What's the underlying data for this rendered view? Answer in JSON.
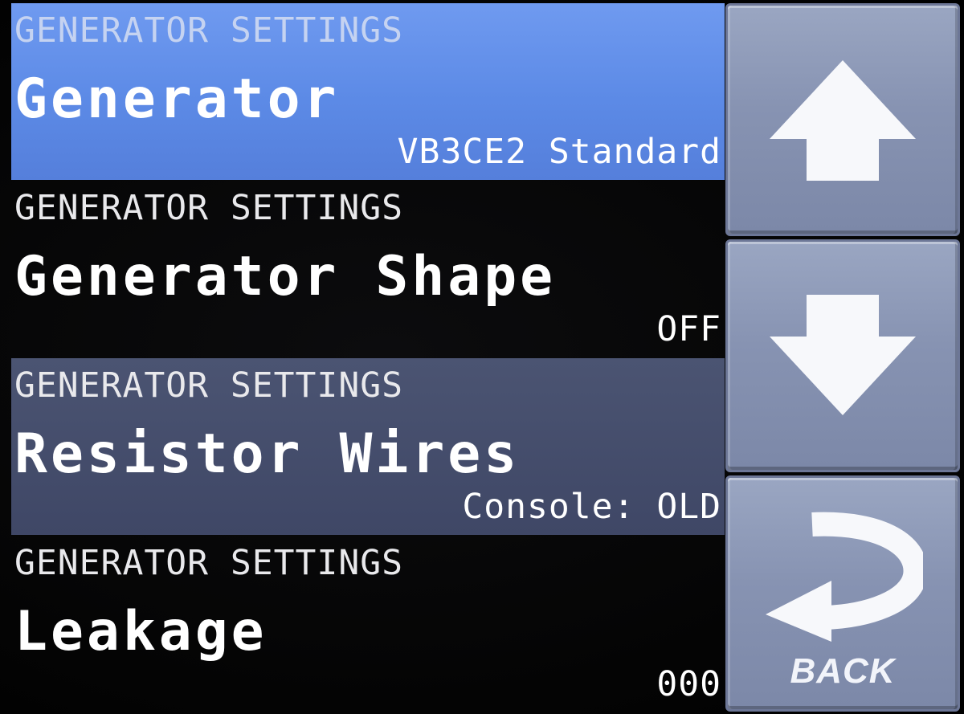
{
  "settings": {
    "items": [
      {
        "category": "GENERATOR SETTINGS",
        "name": "Generator",
        "value": "VB3CE2 Standard"
      },
      {
        "category": "GENERATOR SETTINGS",
        "name": "Generator Shape",
        "value": "OFF"
      },
      {
        "category": "GENERATOR SETTINGS",
        "name": "Resistor Wires",
        "value": "Console: OLD"
      },
      {
        "category": "GENERATOR SETTINGS",
        "name": "Leakage",
        "value": "000"
      }
    ]
  },
  "nav": {
    "back_label": "BACK"
  },
  "colors": {
    "selected_row": "#5c8ae6",
    "highlight_row": "#434b6a",
    "button_face": "#8793b2",
    "background": "#050505"
  }
}
